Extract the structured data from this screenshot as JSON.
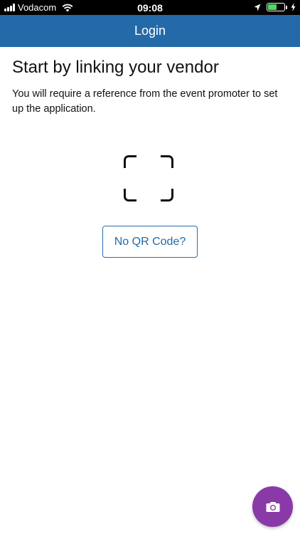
{
  "status_bar": {
    "carrier": "Vodacom",
    "time": "09:08",
    "battery_level": 0.55,
    "icons": [
      "signal-icon",
      "wifi-icon",
      "location-icon",
      "battery-icon",
      "charging-icon"
    ]
  },
  "nav": {
    "title": "Login"
  },
  "main": {
    "heading": "Start by linking your vendor",
    "description": "You will require a reference from the event promoter to set up the application.",
    "scan_icon": "qr-scan-frame-icon",
    "no_qr_button": "No QR Code?"
  },
  "fab": {
    "icon": "camera-icon",
    "color": "#8a3aa8"
  },
  "colors": {
    "nav_background": "#2469a8",
    "button_text": "#2469a8",
    "battery_fill": "#4cd964"
  }
}
